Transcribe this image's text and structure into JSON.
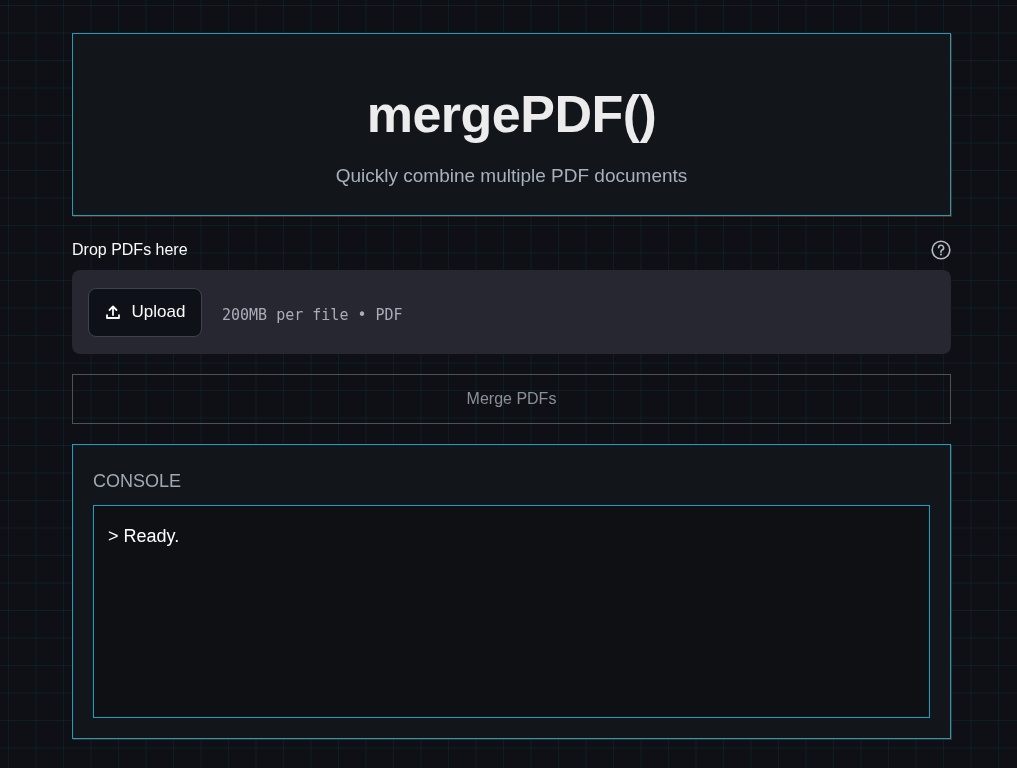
{
  "header": {
    "title": "mergePDF()",
    "subtitle": "Quickly combine multiple PDF documents"
  },
  "uploader": {
    "label": "Drop PDFs here",
    "button": "Upload",
    "limits": "200MB per file • PDF"
  },
  "merge_button": {
    "label": "Merge PDFs",
    "disabled": true
  },
  "console": {
    "title": "CONSOLE",
    "lines": [
      "> Ready."
    ]
  }
}
